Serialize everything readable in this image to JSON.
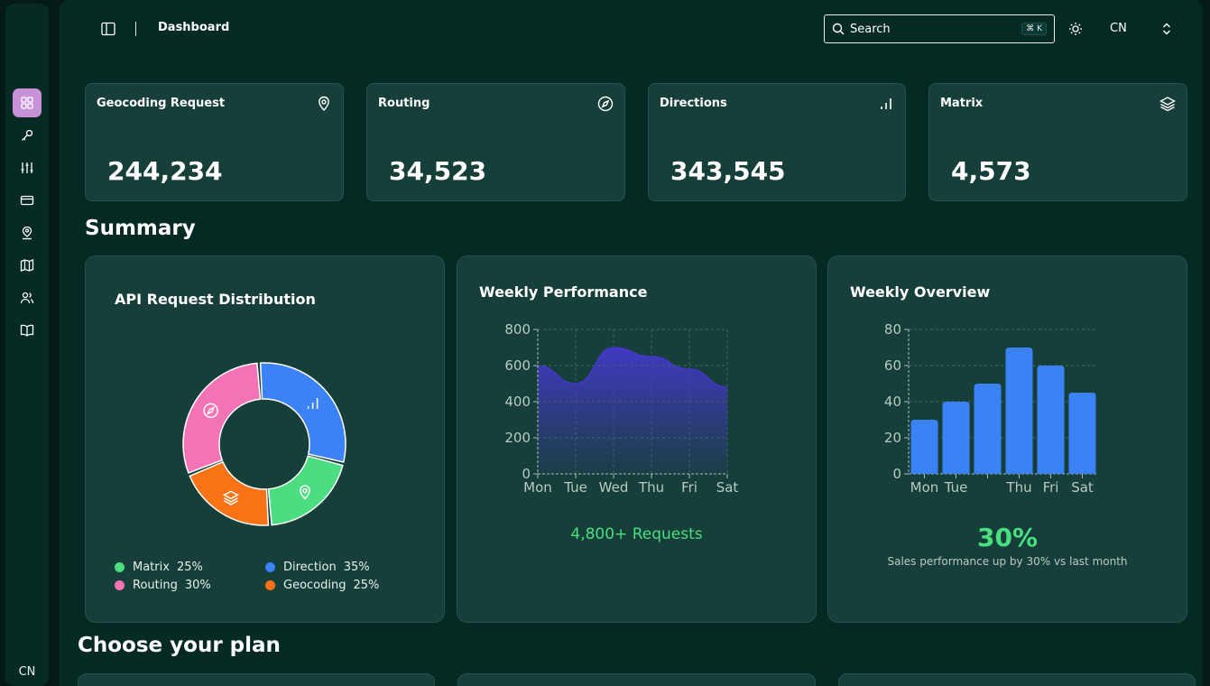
{
  "rail": {
    "icons": [
      "grid-icon",
      "key-icon",
      "sliders-icon",
      "credit-card-icon",
      "map-pin-user-icon",
      "map-icon",
      "users-icon",
      "book-open-icon"
    ],
    "footer": "CN",
    "active_color": "#c792d8"
  },
  "topbar": {
    "title": "Dashboard",
    "search_label": "Search",
    "shortcut": "⌘ K",
    "lang": "CN"
  },
  "stats": [
    {
      "title": "Geocoding Request",
      "value": "244,234",
      "icon": "map-pin-icon"
    },
    {
      "title": "Routing",
      "value": "34,523",
      "icon": "compass-icon"
    },
    {
      "title": "Directions",
      "value": "343,545",
      "icon": "bar-chart-icon"
    },
    {
      "title": "Matrix",
      "value": "4,573",
      "icon": "layers-icon"
    }
  ],
  "summary": {
    "title": "Summary",
    "distribution": {
      "title": "API Request Distribution",
      "legend": [
        {
          "label": "Matrix",
          "pct": "25%",
          "color": "#4ade80"
        },
        {
          "label": "Direction",
          "pct": "35%",
          "color": "#3b82f6"
        },
        {
          "label": "Routing",
          "pct": "30%",
          "color": "#f472b6"
        },
        {
          "label": "Geocoding",
          "pct": "25%",
          "color": "#f97316"
        }
      ]
    },
    "performance": {
      "title": "Weekly Performance",
      "requests": "4,800+ Requests"
    },
    "overview": {
      "title": "Weekly Overview",
      "percent": "30%",
      "note": "Sales performance up by 30% vs last month"
    }
  },
  "plans": {
    "title": "Choose your plan"
  },
  "chart_data": [
    {
      "type": "pie",
      "title": "API Request Distribution",
      "categories": [
        "Direction",
        "Matrix",
        "Geocoding",
        "Routing"
      ],
      "values": [
        30,
        20,
        20,
        30
      ],
      "colors": [
        "#3b82f6",
        "#4ade80",
        "#f97316",
        "#f472b6"
      ],
      "donut": true
    },
    {
      "type": "area",
      "title": "Weekly Performance",
      "x": [
        "Mon",
        "Tue",
        "Wed",
        "Thu",
        "Fri",
        "Sat"
      ],
      "values": [
        600,
        500,
        700,
        650,
        580,
        480
      ],
      "ylim": [
        0,
        800
      ],
      "yticks": [
        0,
        200,
        400,
        600,
        800
      ],
      "grid": true,
      "color": "#4338ca"
    },
    {
      "type": "bar",
      "title": "Weekly Overview",
      "categories": [
        "Mon",
        "Tue",
        "",
        "Thu",
        "Fri",
        "Sat"
      ],
      "values": [
        30,
        40,
        50,
        70,
        60,
        45
      ],
      "ylim": [
        0,
        80
      ],
      "yticks": [
        0,
        20,
        40,
        60,
        80
      ],
      "grid": true,
      "color": "#3b82f6"
    }
  ]
}
